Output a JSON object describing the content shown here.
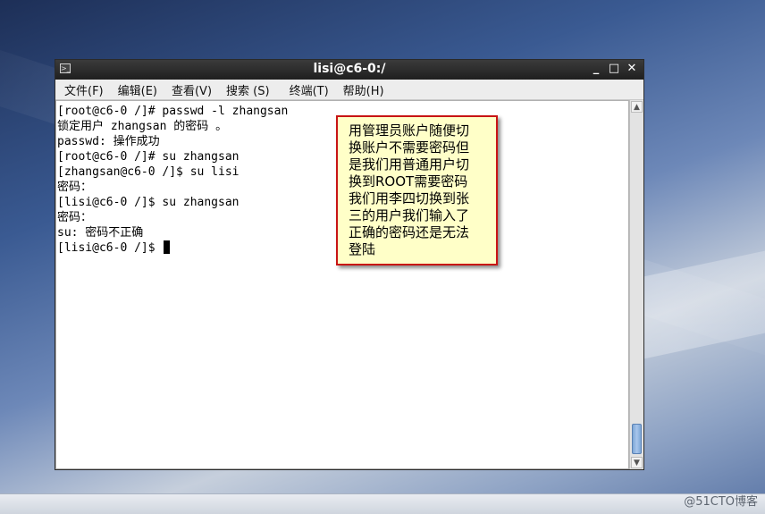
{
  "window": {
    "title": "lisi@c6-0:/",
    "controls": {
      "minimize": "_",
      "maximize": "□",
      "close": "✕"
    }
  },
  "menu": [
    "文件(F)",
    "编辑(E)",
    "查看(V)",
    "搜索 (S)",
    "终端(T)",
    "帮助(H)"
  ],
  "terminal": {
    "lines": [
      "[root@c6-0 /]# passwd -l zhangsan",
      "锁定用户 zhangsan 的密码 。",
      "passwd: 操作成功",
      "[root@c6-0 /]# su zhangsan",
      "[zhangsan@c6-0 /]$ su lisi",
      "密码：",
      "[lisi@c6-0 /]$ su zhangsan",
      "密码：",
      "su: 密码不正确"
    ],
    "prompt": "[lisi@c6-0 /]$ "
  },
  "annotation": {
    "lines": [
      "用管理员账户随便切",
      "换账户不需要密码但",
      "是我们用普通用户切",
      "换到ROOT需要密码",
      "我们用李四切换到张",
      "三的用户我们输入了",
      "正确的密码还是无法",
      "登陆"
    ]
  },
  "watermark": "@51CTO博客"
}
